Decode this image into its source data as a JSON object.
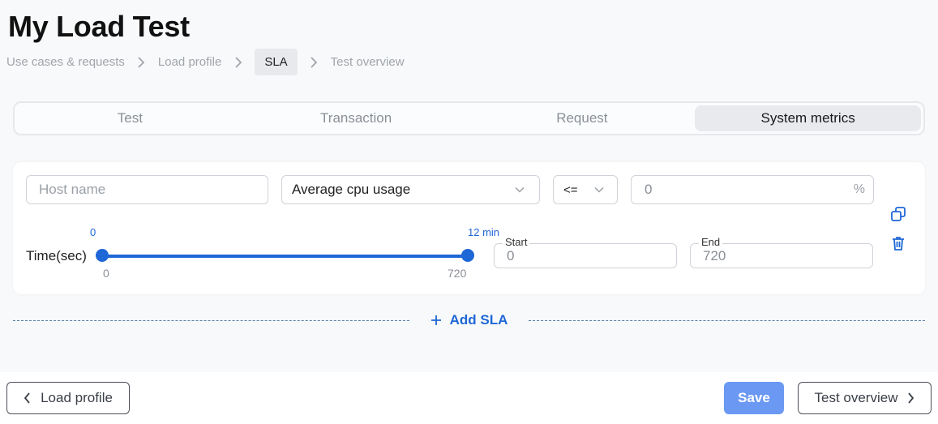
{
  "page": {
    "title": "My Load Test"
  },
  "breadcrumb": {
    "items": [
      "Use cases & requests",
      "Load profile",
      "SLA",
      "Test overview"
    ],
    "active_index": 2
  },
  "tabs": {
    "items": [
      "Test",
      "Transaction",
      "Request",
      "System metrics"
    ],
    "active_index": 3
  },
  "sla": {
    "host_placeholder": "Host name",
    "metric_value": "Average cpu usage",
    "operator_value": "<=",
    "threshold_value": "0",
    "threshold_suffix": "%",
    "time_label": "Time(sec)",
    "slider": {
      "top_min_label": "0",
      "top_max_label": "12 min",
      "bottom_min_label": "0",
      "bottom_max_label": "720",
      "range_start": 0,
      "range_end": 720
    },
    "start_label": "Start",
    "start_value": "0",
    "end_label": "End",
    "end_value": "720"
  },
  "add_sla_label": "Add SLA",
  "footer": {
    "back_label": "Load profile",
    "save_label": "Save",
    "next_label": "Test overview"
  },
  "colors": {
    "accent": "#1e67d6",
    "primary_button": "#6b98f3",
    "background": "#f8f9fa"
  },
  "icons": [
    "chevron-right-icon",
    "chevron-down-icon",
    "copy-icon",
    "trash-icon",
    "plus-icon",
    "chevron-left-icon"
  ]
}
